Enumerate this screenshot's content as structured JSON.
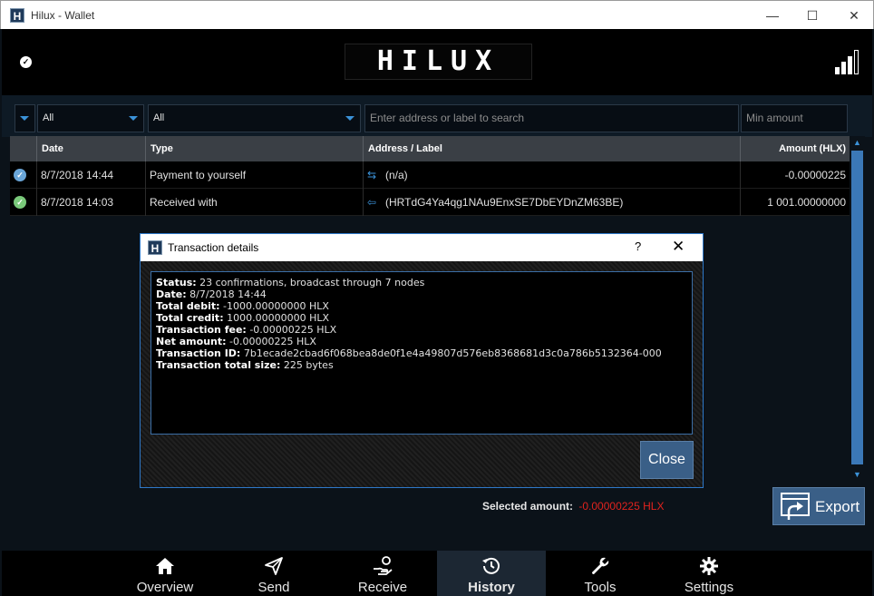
{
  "window": {
    "title": "Hilux - Wallet",
    "minimize": "—",
    "maximize": "☐",
    "close": "✕"
  },
  "header": {
    "logo_text": "HILUX"
  },
  "filters": {
    "date_filter": "All",
    "type_filter": "All",
    "search_placeholder": "Enter address or label to search",
    "min_amount_placeholder": "Min amount"
  },
  "table": {
    "columns": [
      "Date",
      "Type",
      "Address / Label",
      "Amount (HLX)"
    ],
    "rows": [
      {
        "date": "8/7/2018 14:44",
        "type": "Payment to yourself",
        "address": "(n/a)",
        "amount": "-0.00000225",
        "status_color": "#6aa6d8"
      },
      {
        "date": "8/7/2018 14:03",
        "type": "Received with",
        "address": "(HRTdG4Ya4qg1NAu9EnxSE7DbEYDnZM63BE)",
        "amount": "1 001.00000000",
        "status_color": "#7ac97a"
      }
    ]
  },
  "dialog": {
    "title": "Transaction details",
    "help": "?",
    "close_x": "✕",
    "lines": [
      {
        "label": "Status:",
        "value": " 23 confirmations, broadcast through 7 nodes"
      },
      {
        "label": "Date:",
        "value": " 8/7/2018 14:44"
      },
      {
        "label": "Total debit:",
        "value": " -1000.00000000 HLX"
      },
      {
        "label": "Total credit:",
        "value": " 1000.00000000 HLX"
      },
      {
        "label": "Transaction fee:",
        "value": " -0.00000225 HLX"
      },
      {
        "label": "Net amount:",
        "value": " -0.00000225 HLX"
      },
      {
        "label": "Transaction ID:",
        "value": " 7b1ecade2cbad6f068bea8de0f1e4a49807d576eb8368681d3c0a786b5132364-000"
      },
      {
        "label": "Transaction total size:",
        "value": " 225 bytes"
      }
    ],
    "close_button": "Close"
  },
  "footer": {
    "selected_label": "Selected amount:",
    "selected_amount": "-0.00000225 HLX",
    "export_label": "Export"
  },
  "nav": [
    {
      "label": "Overview",
      "icon": "home-icon"
    },
    {
      "label": "Send",
      "icon": "paper-plane-icon"
    },
    {
      "label": "Receive",
      "icon": "hand-coin-icon"
    },
    {
      "label": "History",
      "icon": "history-icon",
      "active": true
    },
    {
      "label": "Tools",
      "icon": "wrench-icon"
    },
    {
      "label": "Settings",
      "icon": "gear-icon"
    }
  ],
  "colors": {
    "accent": "#3b92d8",
    "button": "#3a5f87",
    "negative": "#e0231e"
  }
}
